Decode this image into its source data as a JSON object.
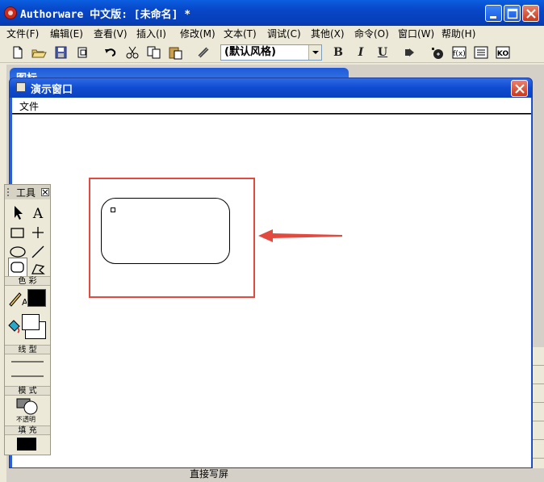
{
  "app": {
    "title": "Authorware 中文版: [未命名] *",
    "icon": "authorware-icon",
    "controls": [
      "minimize-icon",
      "maximize-icon",
      "close-icon"
    ]
  },
  "menubar": {
    "items": [
      "文件(F)",
      "编辑(E)",
      "查看(V)",
      "插入(I)",
      "修改(M)",
      "文本(T)",
      "调试(C)",
      "其他(X)",
      "命令(O)",
      "窗口(W)",
      "帮助(H)"
    ]
  },
  "toolbar": {
    "style_select": "(默认风格)",
    "bold": "B",
    "italic": "I",
    "underline": "U",
    "icons": [
      "new-icon",
      "open-icon",
      "save-all-icon",
      "import-icon",
      "undo-icon",
      "cut-icon",
      "copy-icon",
      "paste-icon",
      "find-icon",
      "bold-icon",
      "italic-icon",
      "underline-icon",
      "run-icon",
      "control-panel-icon",
      "functions-icon",
      "variables-icon",
      "knowledge-objects-icon"
    ]
  },
  "background": {
    "back_window_label": "图标",
    "status_text": "直接写屏"
  },
  "presentation": {
    "title": "演示窗口",
    "menu_file": "文件"
  },
  "tools": {
    "title": "工具",
    "color_label": "色 彩",
    "line_label": "线 型",
    "mode_label": "模 式",
    "mode_value": "不透明",
    "fill_label": "填 充",
    "stroke_color": "#000000",
    "fill_color": "#000000",
    "tool_icons": [
      "pointer-icon",
      "text-tool-icon",
      "rectangle-tool-icon",
      "cross-tool-icon",
      "ellipse-tool-icon",
      "line-tool-icon",
      "rounded-rect-tool-icon",
      "polygon-tool-icon"
    ]
  },
  "annotation": {
    "highlight_color": "#e24a3f"
  }
}
